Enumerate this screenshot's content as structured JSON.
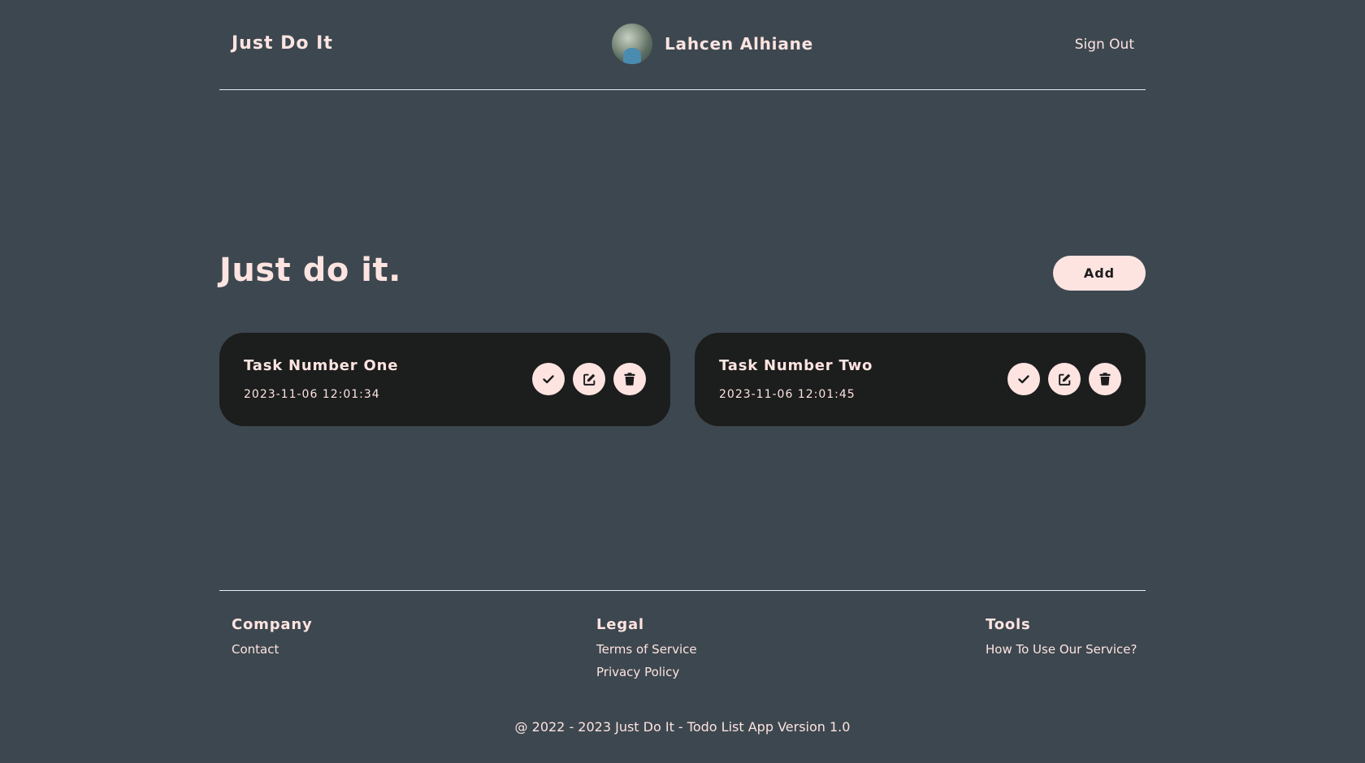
{
  "header": {
    "brand": "Just Do It",
    "user_name": "Lahcen Alhiane",
    "sign_out": "Sign Out"
  },
  "main": {
    "title": "Just do it.",
    "add_label": "Add",
    "tasks": [
      {
        "title": "Task Number One",
        "date": "2023-11-06 12:01:34"
      },
      {
        "title": "Task Number Two",
        "date": "2023-11-06 12:01:45"
      }
    ]
  },
  "footer": {
    "columns": [
      {
        "heading": "Company",
        "links": [
          "Contact"
        ]
      },
      {
        "heading": "Legal",
        "links": [
          "Terms of Service",
          "Privacy Policy"
        ]
      },
      {
        "heading": "Tools",
        "links": [
          "How To Use Our Service?"
        ]
      }
    ],
    "copyright": "@ 2022 - 2023 Just Do It - Todo List App Version 1.0"
  },
  "colors": {
    "background": "#3d474f",
    "card": "#1c1d1d",
    "accent": "#fde4e1"
  },
  "icons": [
    "check-icon",
    "edit-icon",
    "trash-icon"
  ]
}
